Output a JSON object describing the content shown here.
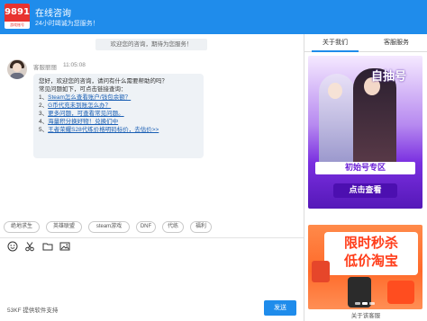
{
  "header": {
    "logo_text": "9891",
    "logo_subtext": "游戏账号",
    "title": "在线咨询",
    "subtitle": "24小时竭诚为您服务！"
  },
  "chat": {
    "welcome": "欢迎您的咨询，期待为您服务！",
    "agent_name": "客服丽丽",
    "time": "11:05:08",
    "message_lines": [
      "您好，欢迎您的咨询，请问有什么需要帮助的吗？",
      "常见问题如下，可点击链接查询："
    ],
    "faq": [
      {
        "num": "1、",
        "text": "Steam怎么查看账户/钱包余额？"
      },
      {
        "num": "2、",
        "text": "G币代充未到账怎么办？"
      },
      {
        "num": "3、",
        "text": "更多问题，可查看常见问题。"
      },
      {
        "num": "4、",
        "text": "海量积分换好物！兑换们中"
      },
      {
        "num": "5、",
        "text": "王者荣耀S28代练价格明码标价，去估价>>"
      }
    ]
  },
  "tags": [
    "绝地求生",
    "英雄联盟",
    "steam游戏",
    "DNF",
    "代练",
    "福利"
  ],
  "toolbar": {
    "icons": [
      "smile-icon",
      "scissors-icon",
      "folder-icon",
      "image-icon"
    ]
  },
  "footer": {
    "provider": "53KF 提供软件支持",
    "send_label": "发送"
  },
  "right_panel": {
    "tabs": [
      "关于我们",
      "客服服务"
    ],
    "ad1": {
      "headline": "自抽号",
      "subline": "初始号专区",
      "cta": "点击查看"
    },
    "ad2": {
      "line1": "限时秒杀",
      "line2": "低价淘宝"
    },
    "footer_link": "关于该客服"
  },
  "colors": {
    "accent": "#1f8ceb",
    "logo_red": "#e8322f",
    "bubble_bg": "#eef2f6",
    "link": "#1a5fb4"
  }
}
